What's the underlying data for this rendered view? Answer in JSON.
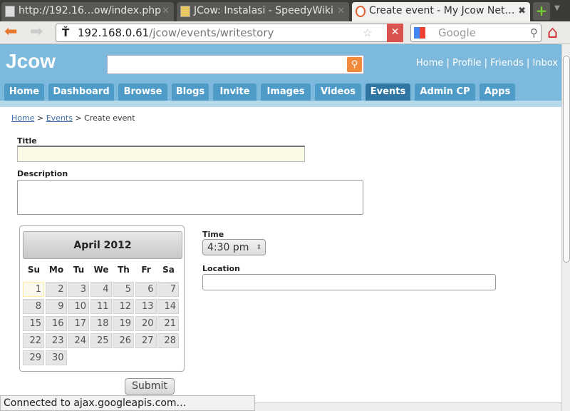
{
  "browser": {
    "tabs": [
      {
        "label": "http://192.16…ow/index.php"
      },
      {
        "label": "JCow: Instalasi - SpeedyWiki"
      },
      {
        "label": "Create event - My Jcow Net…"
      }
    ],
    "url_host": "192.168.0.61",
    "url_path": "/jcow/events/writestory",
    "search_placeholder": "Google",
    "status": "Connected to ajax.googleapis.com…"
  },
  "site": {
    "logo": "Jcow",
    "toplinks": "Home | Profile | Friends | Inbox | I",
    "nav": [
      {
        "label": "Home"
      },
      {
        "label": "Dashboard"
      },
      {
        "label": "Browse"
      },
      {
        "label": "Blogs"
      },
      {
        "label": "Invite"
      },
      {
        "label": "Images"
      },
      {
        "label": "Videos"
      },
      {
        "label": "Events",
        "active": true
      },
      {
        "label": "Admin CP"
      },
      {
        "label": "Apps"
      }
    ]
  },
  "breadcrumb": {
    "home": "Home",
    "events": "Events",
    "current": "Create event",
    "sep": ">"
  },
  "form": {
    "title_label": "Title",
    "title_value": "",
    "description_label": "Description",
    "description_value": "",
    "time_label": "Time",
    "time_value": "4:30 pm",
    "location_label": "Location",
    "location_value": "",
    "submit": "Submit"
  },
  "calendar": {
    "month": "April 2012",
    "weekdays": [
      "Su",
      "Mo",
      "Tu",
      "We",
      "Th",
      "Fr",
      "Sa"
    ],
    "first_weekday": 0,
    "days_in_month": 30,
    "selected": 1
  }
}
